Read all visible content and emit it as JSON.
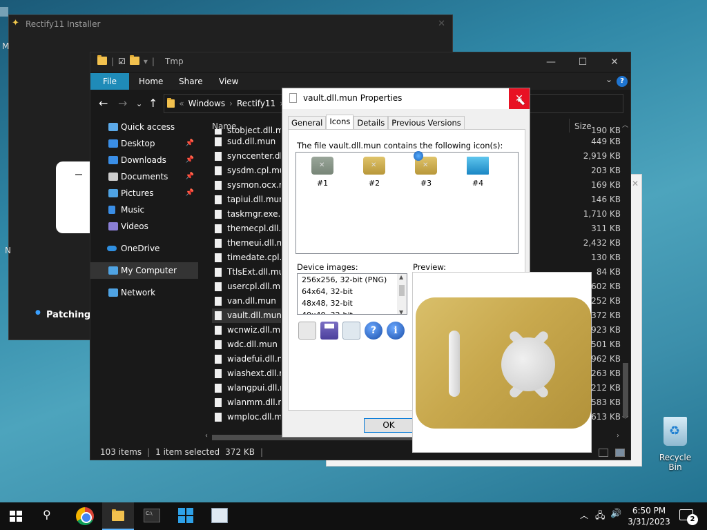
{
  "installer": {
    "title": "Rectify11 Installer",
    "status_text": "Patching v",
    "desktop_letter_m": "M",
    "desktop_letter_n": "N"
  },
  "explorer": {
    "title": "Tmp",
    "ribbon_tabs": [
      "File",
      "Home",
      "Share",
      "View"
    ],
    "breadcrumb": [
      "Windows",
      "Rectify11"
    ],
    "sidebar": [
      {
        "label": "Quick access",
        "icon": "star-icon",
        "color": "#5ba9e8",
        "pinned": false
      },
      {
        "label": "Desktop",
        "icon": "desktop-icon",
        "color": "#3a8ee6",
        "pinned": true
      },
      {
        "label": "Downloads",
        "icon": "download-icon",
        "color": "#3a8ee6",
        "pinned": true
      },
      {
        "label": "Documents",
        "icon": "document-icon",
        "color": "#cccccc",
        "pinned": true
      },
      {
        "label": "Pictures",
        "icon": "picture-icon",
        "color": "#4fa3e3",
        "pinned": true
      },
      {
        "label": "Music",
        "icon": "music-icon",
        "color": "#3a8ee6",
        "pinned": false
      },
      {
        "label": "Videos",
        "icon": "video-icon",
        "color": "#8a7fd6",
        "pinned": false
      },
      {
        "label": "OneDrive",
        "icon": "cloud-icon",
        "color": "#2f8fe0",
        "pinned": false
      },
      {
        "label": "My Computer",
        "icon": "computer-icon",
        "color": "#4fa3e3",
        "pinned": false
      },
      {
        "label": "Network",
        "icon": "network-icon",
        "color": "#4fa3e3",
        "pinned": false
      }
    ],
    "columns": {
      "name": "Name",
      "size": "Size"
    },
    "files": [
      {
        "name": "stobject.dll.mun",
        "size": "190 KB"
      },
      {
        "name": "sud.dll.mun",
        "size": "449 KB"
      },
      {
        "name": "synccenter.dll.mun",
        "size": "2,919 KB"
      },
      {
        "name": "sysdm.cpl.mun",
        "size": "203 KB"
      },
      {
        "name": "sysmon.ocx.mun",
        "size": "169 KB"
      },
      {
        "name": "tapiui.dll.mun",
        "size": "146 KB"
      },
      {
        "name": "taskmgr.exe.mun",
        "size": "1,710 KB"
      },
      {
        "name": "themecpl.dll.mun",
        "size": "311 KB"
      },
      {
        "name": "themeui.dll.mun",
        "size": "2,432 KB"
      },
      {
        "name": "timedate.cpl.mun",
        "size": "130 KB"
      },
      {
        "name": "TtlsExt.dll.mun",
        "size": "84 KB"
      },
      {
        "name": "usercpl.dll.mun",
        "size": "602 KB"
      },
      {
        "name": "van.dll.mun",
        "size": "252 KB"
      },
      {
        "name": "vault.dll.mun",
        "size": "372 KB",
        "selected": true
      },
      {
        "name": "wcnwiz.dll.mun",
        "size": "923 KB"
      },
      {
        "name": "wdc.dll.mun",
        "size": "501 KB"
      },
      {
        "name": "wiadefui.dll.mun",
        "size": "962 KB"
      },
      {
        "name": "wiashext.dll.mun",
        "size": "1,263 KB"
      },
      {
        "name": "wlangpui.dll.mun",
        "size": "212 KB"
      },
      {
        "name": "wlanmm.dll.mun",
        "size": "1,583 KB"
      },
      {
        "name": "wmploc.dll.mun",
        "size": "1,613 KB"
      }
    ],
    "status": {
      "items": "103 items",
      "selected": "1 item selected",
      "size": "372 KB"
    }
  },
  "properties": {
    "title": "vault.dll.mun Properties",
    "tabs": [
      "General",
      "Icons",
      "Details",
      "Previous Versions"
    ],
    "active_tab": "Icons",
    "description": "The file vault.dll.mun contains the following icon(s):",
    "icons": [
      {
        "label": "#1",
        "style": "gray"
      },
      {
        "label": "#2",
        "style": "gold"
      },
      {
        "label": "#3",
        "style": "gold-globe"
      },
      {
        "label": "#4",
        "style": "monitor"
      }
    ],
    "device_images_label": "Device images:",
    "preview_label": "Preview:",
    "device_images": [
      "256x256, 32-bit (PNG)",
      "64x64, 32-bit",
      "48x48, 32-bit",
      "40x40, 32-bit"
    ],
    "ok_label": "OK",
    "colors": {
      "close": "#e81123",
      "vault_gold": "#c8a84d"
    }
  },
  "desktop": {
    "recycle_bin": "Recycle Bin"
  },
  "taskbar": {
    "time": "6:50 PM",
    "date": "3/31/2023",
    "notification_count": "2"
  }
}
